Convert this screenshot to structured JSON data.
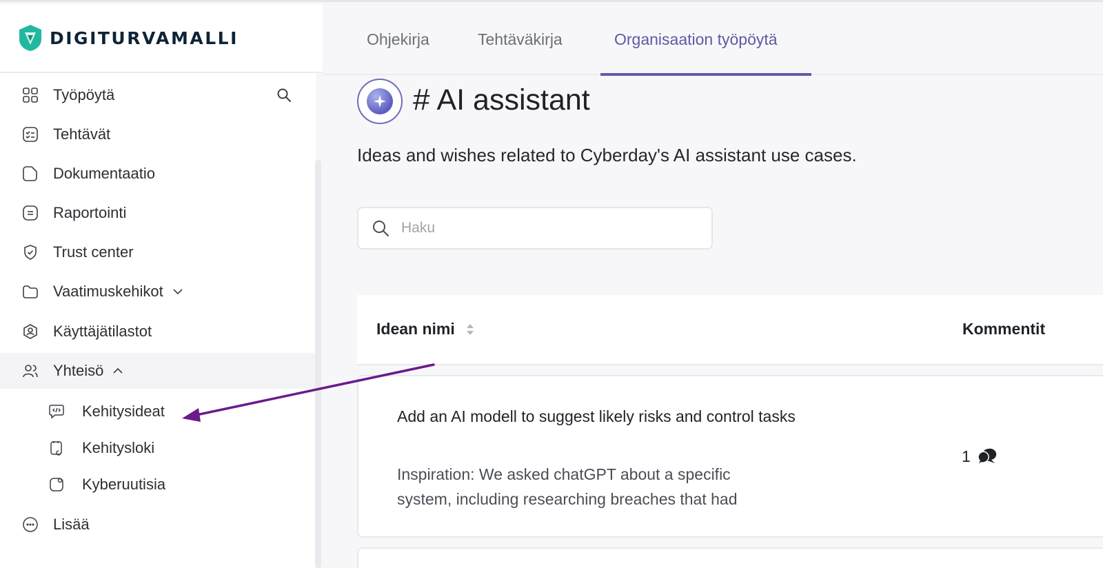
{
  "brand": {
    "name": "DIGITURVAMALLI",
    "color": "#1fb39a"
  },
  "topnav": {
    "tabs": [
      {
        "label": "Ohjekirja"
      },
      {
        "label": "Tehtäväkirja"
      },
      {
        "label": "Organisaation työpöytä",
        "active": true
      }
    ],
    "accent": "#5f5ba8"
  },
  "sidebar": {
    "items": [
      {
        "label": "Työpöytä",
        "icon": "grid-icon"
      },
      {
        "label": "Tehtävät",
        "icon": "checklist-icon"
      },
      {
        "label": "Dokumentaatio",
        "icon": "document-icon"
      },
      {
        "label": "Raportointi",
        "icon": "report-icon"
      },
      {
        "label": "Trust center",
        "icon": "shield-icon"
      },
      {
        "label": "Vaatimuskehikot",
        "icon": "folder-icon",
        "expanded": false
      },
      {
        "label": "Käyttäjätilastot",
        "icon": "user-badge-icon"
      },
      {
        "label": "Yhteisö",
        "icon": "people-icon",
        "expanded": true
      },
      {
        "label": "Kehitysideat",
        "icon": "code-chat-icon",
        "sub": true
      },
      {
        "label": "Kehitysloki",
        "icon": "log-icon",
        "sub": true
      },
      {
        "label": "Kyberuutisia",
        "icon": "news-icon",
        "sub": true
      },
      {
        "label": "Lisää",
        "icon": "more-icon"
      }
    ]
  },
  "channel": {
    "hash": "#",
    "title": "AI assistant",
    "description": "Ideas and wishes related to Cyberday's AI assistant use cases."
  },
  "search": {
    "placeholder": "Haku",
    "value": ""
  },
  "table": {
    "columns": [
      "Idean nimi",
      "Kommentit"
    ],
    "rows": [
      {
        "title": "Add an AI modell to suggest likely risks and control tasks",
        "description": "Inspiration: We asked chatGPT about a specific system, including researching breaches that had",
        "comments": "1"
      }
    ]
  },
  "annotation": {
    "arrow_color": "#6a1b8c",
    "points_to": "Kehitysideat"
  }
}
